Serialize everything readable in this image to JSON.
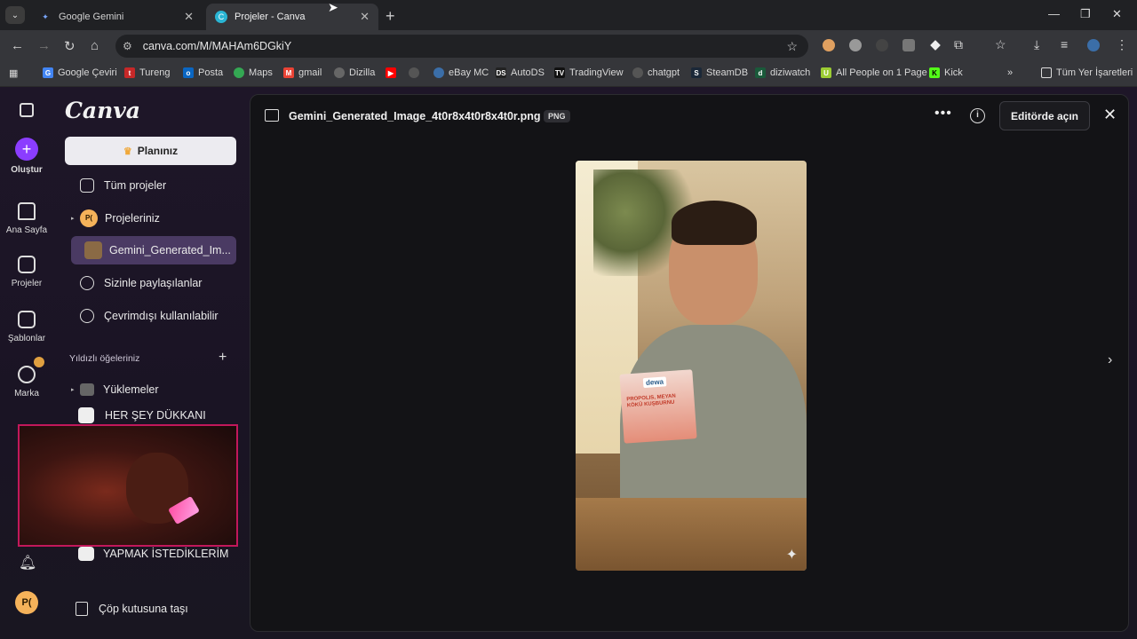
{
  "browser": {
    "tabs": [
      {
        "title": "Google Gemini",
        "active": false
      },
      {
        "title": "Projeler - Canva",
        "active": true
      }
    ],
    "url": "canva.com/M/MAHAm6DGkiY",
    "bookmarks": [
      "Google Çeviri",
      "Tureng",
      "Posta",
      "Maps",
      "gmail",
      "Dizilla",
      "eBay MC",
      "AutoDS",
      "TradingView",
      "chatgpt",
      "SteamDB",
      "diziwatch",
      "All People on 1 Page",
      "Kick"
    ],
    "all_bookmarks": "Tüm Yer İşaretleri"
  },
  "rail": {
    "create": "Oluştur",
    "home": "Ana Sayfa",
    "projects": "Projeler",
    "templates": "Şablonlar",
    "brand": "Marka",
    "avatar": "P("
  },
  "panel": {
    "logo": "Canva",
    "plan": "Planınız",
    "nav": [
      {
        "label": "Tüm projeler",
        "selected": false
      },
      {
        "label": "Projeleriniz",
        "selected": false
      },
      {
        "label": "Gemini_Generated_Im...",
        "selected": true
      },
      {
        "label": "Sizinle paylaşılanlar",
        "selected": false
      },
      {
        "label": "Çevrimdışı kullanılabilir",
        "selected": false
      }
    ],
    "starred_heading": "Yıldızlı öğeleriniz",
    "starred": [
      "Yüklemeler",
      "HER ŞEY DÜKKANI",
      "YAPMAK İSTEDİKLERİM"
    ],
    "trash": "Çöp kutusuna taşı",
    "avatar_initials": "P("
  },
  "viewer": {
    "filename": "Gemini_Generated_Image_4t0r8x4t0r8x4t0r.png",
    "file_type": "PNG",
    "open_editor": "Editörde açın",
    "product_brand": "dewa",
    "product_text": "PROPOLIS, MEYAN KÖKÜ KUŞBURNU"
  }
}
